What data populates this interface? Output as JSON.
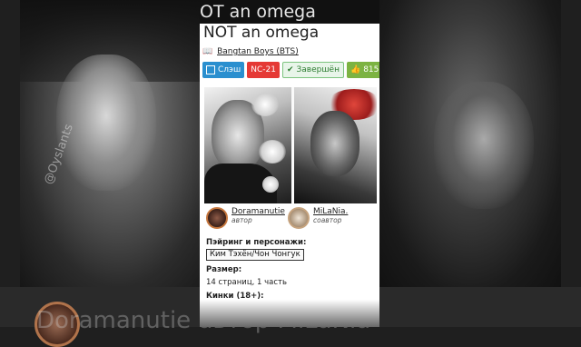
{
  "background": {
    "left_watermark": "@Oyslants",
    "bottom_ghost_text": "Doramanutie     автор    MiLaNia"
  },
  "work": {
    "ghost_title": "OT an omega",
    "title": "NOT an omega",
    "fandom": "Bangtan Boys (BTS)",
    "badges": {
      "direction": "Слэш",
      "rating": "NC-21",
      "status": "Завершён",
      "likes": "815"
    }
  },
  "authors": [
    {
      "name": "Doramanutie",
      "role": "автор"
    },
    {
      "name": "MiLaNia.",
      "role": "соавтор"
    }
  ],
  "details": {
    "pairing_label": "Пэйринг и персонажи:",
    "pairing_value": "Ким Тэхён/Чон Чонгук",
    "size_label": "Размер:",
    "size_value": "14 страниц, 1 часть",
    "kinks_label": "Кинки (18+):"
  },
  "colors": {
    "slash": "#2a8fcf",
    "rating": "#e53935",
    "status": "#2e7d32",
    "likes": "#7cb342"
  }
}
